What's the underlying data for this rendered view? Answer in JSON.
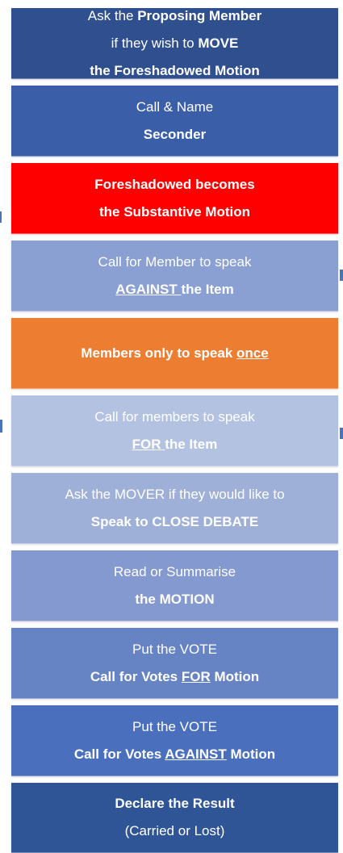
{
  "steps": [
    {
      "color": "#2f4f8f",
      "lines": [
        [
          {
            "t": "Ask the "
          },
          {
            "t": "Proposing Member",
            "b": true
          }
        ],
        [
          {
            "t": "if they wish to "
          },
          {
            "t": "MOVE",
            "b": true
          }
        ],
        [
          {
            "t": "the Foreshadowed Motion",
            "b": true
          }
        ]
      ]
    },
    {
      "color": "#3a5ea8",
      "lines": [
        [
          {
            "t": "Call & Name"
          }
        ],
        [
          {
            "t": "Seconder",
            "b": true
          }
        ]
      ]
    },
    {
      "color": "#ff0000",
      "lines": [
        [
          {
            "t": "Foreshadowed becomes",
            "b": true
          }
        ],
        [
          {
            "t": "the Substantive Motion",
            "b": true
          }
        ]
      ]
    },
    {
      "color": "#8a9fd2",
      "lines": [
        [
          {
            "t": "Call for Member to speak"
          }
        ],
        [
          {
            "t": "AGAINST ",
            "b": true,
            "u": true
          },
          {
            "t": "the Item",
            "b": true
          }
        ]
      ]
    },
    {
      "color": "#ed7d31",
      "lines": [
        [
          {
            "t": "Members only to speak ",
            "b": true
          },
          {
            "t": "once",
            "b": true,
            "u": true
          }
        ]
      ]
    },
    {
      "color": "#b4c2e1",
      "lines": [
        [
          {
            "t": "Call for members to speak"
          }
        ],
        [
          {
            "t": " FOR ",
            "b": true,
            "u": true
          },
          {
            "t": "the Item",
            "b": true
          }
        ]
      ]
    },
    {
      "color": "#9fb0d8",
      "lines": [
        [
          {
            "t": "Ask the MOVER if they would like to"
          }
        ],
        [
          {
            "t": "Speak to CLOSE DEBATE",
            "b": true
          }
        ]
      ]
    },
    {
      "color": "#8499cf",
      "lines": [
        [
          {
            "t": "Read or Summarise"
          }
        ],
        [
          {
            "t": "the MOTION",
            "b": true
          }
        ]
      ]
    },
    {
      "color": "#6684c4",
      "lines": [
        [
          {
            "t": "Put the VOTE"
          }
        ],
        [
          {
            "t": "Call for Votes ",
            "b": true
          },
          {
            "t": "FOR",
            "b": true,
            "u": true
          },
          {
            "t": " Motion",
            "b": true
          }
        ]
      ]
    },
    {
      "color": "#4a70bd",
      "lines": [
        [
          {
            "t": "Put the VOTE"
          }
        ],
        [
          {
            "t": "Call for Votes ",
            "b": true
          },
          {
            "t": "AGAINST",
            "b": true,
            "u": true
          },
          {
            "t": " Motion",
            "b": true
          }
        ]
      ]
    },
    {
      "color": "#2f5597",
      "lines": [
        [
          {
            "t": "Declare the Result",
            "b": true
          }
        ],
        [
          {
            "t": "(Carried or Lost)"
          }
        ]
      ]
    }
  ]
}
